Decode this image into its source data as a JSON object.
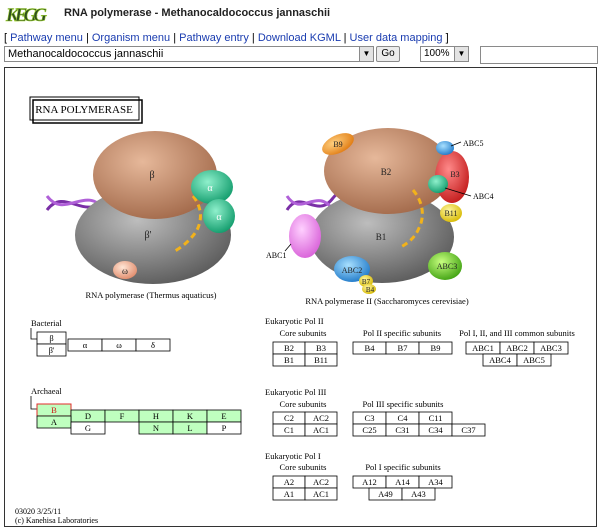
{
  "header": {
    "logo_text": "KEGG",
    "title": "RNA polymerase - Methanocaldococcus jannaschii"
  },
  "menu": {
    "open_bracket": "[",
    "close_bracket": "]",
    "sep": "|",
    "items": [
      "Pathway menu",
      "Organism menu",
      "Pathway entry",
      "Download KGML",
      "User data mapping"
    ]
  },
  "controls": {
    "organism": "Methanocaldococcus jannaschii",
    "go_label": "Go",
    "zoom": "100%",
    "search_value": ""
  },
  "colors": {
    "mapped_fill": "#bfffbf",
    "mapped_border": "#e32b2b",
    "beta_subunit": "#c9916e",
    "core_grey": "#8c8c8c"
  },
  "diagram": {
    "title": "RNA POLYMERASE",
    "left_caption": "RNA polymerase (Thermus aquaticus)",
    "right_caption": "RNA polymerase II (Saccharomyces cerevisiae)",
    "left_labels": {
      "beta": "β",
      "beta_prime": "β'",
      "alpha1": "α",
      "alpha2": "α",
      "omega": "ω"
    },
    "right_labels": {
      "b2": "B2",
      "b1": "B1",
      "b3": "B3",
      "b9": "B9",
      "b11": "B11",
      "abc1": "ABC1",
      "abc2": "ABC2",
      "abc3": "ABC3",
      "abc4": "ABC4",
      "abc5": "ABC5",
      "b7": "B7",
      "b4": "B4"
    },
    "bacterial": {
      "label": "Bacterial",
      "beta": "β",
      "beta_prime": "β'",
      "alpha": "α",
      "omega": "ω",
      "delta": "δ"
    },
    "archaeal": {
      "label": "Archaeal",
      "top": [
        "B",
        "D",
        "F",
        "H",
        "K",
        "E"
      ],
      "bottom": [
        "A",
        "G",
        "N",
        "L",
        "P"
      ]
    },
    "pol2": {
      "title": "Eukaryotic Pol II",
      "core_label": "Core subunits",
      "core": [
        [
          "B2",
          "B3"
        ],
        [
          "B1",
          "B11"
        ]
      ],
      "specific_label": "Pol II specific subunits",
      "specific": [
        "B4",
        "B7",
        "B9"
      ],
      "common_label": "Pol I, II, and III common subunits",
      "common_top": [
        "ABC1",
        "ABC2",
        "ABC3"
      ],
      "common_bottom": [
        "ABC4",
        "ABC5"
      ]
    },
    "pol3": {
      "title": "Eukaryotic Pol III",
      "core_label": "Core subunits",
      "core": [
        [
          "C2",
          "AC2"
        ],
        [
          "C1",
          "AC1"
        ]
      ],
      "specific_label": "Pol III specific subunits",
      "specific_top": [
        "C3",
        "C4",
        "C11"
      ],
      "specific_bottom": [
        "C25",
        "C31",
        "C34",
        "C37"
      ]
    },
    "pol1": {
      "title": "Eukaryotic Pol I",
      "core_label": "Core subunits",
      "core": [
        [
          "A2",
          "AC2"
        ],
        [
          "A1",
          "AC1"
        ]
      ],
      "specific_label": "Pol I specific subunits",
      "specific_top": [
        "A12",
        "A14",
        "A34"
      ],
      "specific_bottom": [
        "A49",
        "A43"
      ]
    },
    "footer": {
      "map_id": "03020 3/25/11",
      "credit": "(c) Kanehisa Laboratories"
    }
  }
}
